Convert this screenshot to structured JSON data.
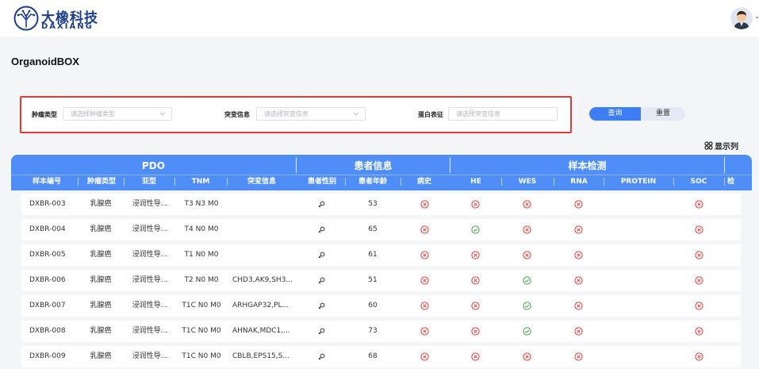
{
  "brand": {
    "name_cn": "大橡科技",
    "name_en": "DAXIANG",
    "color": "#1d3f8a"
  },
  "user": {
    "avatar_icon": "user-avatar-icon",
    "menu_icon": "chevron-down-icon"
  },
  "page": {
    "title": "OrganoidBOX"
  },
  "filters": {
    "tumor_type": {
      "label": "肿瘤类型",
      "placeholder": "请选择肿瘤类型"
    },
    "mutation": {
      "label": "突变信息",
      "placeholder": "请选择突变信息"
    },
    "protein": {
      "label": "蛋白表征",
      "placeholder": "请选择突变信息"
    },
    "highlight_color": "#e53935"
  },
  "buttons": {
    "query": "查询",
    "reset": "重置",
    "accent": "#3d7ef5"
  },
  "show_columns": {
    "label": "显示列",
    "icon": "grid-settings-icon"
  },
  "table": {
    "groups": [
      "PDO",
      "患者信息",
      "样本检测"
    ],
    "columns": [
      "样本编号",
      "肿瘤类型",
      "亚型",
      "TNM",
      "突变信息",
      "患者性别",
      "患者年龄",
      "病史",
      "HE",
      "WES",
      "RNA",
      "PROTEIN",
      "SOC",
      "检"
    ],
    "header_color": "#4f8df7",
    "rows": [
      {
        "id": "DXBR-003",
        "tumor": "乳腺癌",
        "subtype": "浸润性导...",
        "tnm": "T3 N3 M0",
        "mutation": "",
        "sex": "female",
        "age": "53",
        "history": "x",
        "he": "x",
        "wes": "x",
        "rna": "x",
        "protein": "",
        "soc": "x"
      },
      {
        "id": "DXBR-004",
        "tumor": "乳腺癌",
        "subtype": "浸润性导...",
        "tnm": "T4 N0 M0",
        "mutation": "",
        "sex": "female",
        "age": "65",
        "history": "x",
        "he": "ok",
        "wes": "x",
        "rna": "x",
        "protein": "",
        "soc": "x"
      },
      {
        "id": "DXBR-005",
        "tumor": "乳腺癌",
        "subtype": "浸润性导...",
        "tnm": "T1 N0 M0",
        "mutation": "",
        "sex": "female",
        "age": "61",
        "history": "x",
        "he": "x",
        "wes": "x",
        "rna": "x",
        "protein": "",
        "soc": "x"
      },
      {
        "id": "DXBR-006",
        "tumor": "乳腺癌",
        "subtype": "浸润性导...",
        "tnm": "T2 N0 M0",
        "mutation": "CHD3,AK9,SH3...",
        "sex": "female",
        "age": "51",
        "history": "x",
        "he": "x",
        "wes": "ok",
        "rna": "x",
        "protein": "",
        "soc": "x"
      },
      {
        "id": "DXBR-007",
        "tumor": "乳腺癌",
        "subtype": "浸润性导...",
        "tnm": "T1C N0 M0",
        "mutation": "ARHGAP32,PL...",
        "sex": "female",
        "age": "60",
        "history": "x",
        "he": "x",
        "wes": "ok",
        "rna": "x",
        "protein": "",
        "soc": "x"
      },
      {
        "id": "DXBR-008",
        "tumor": "乳腺癌",
        "subtype": "浸润性导...",
        "tnm": "T1C N0 M0",
        "mutation": "AHNAK,MDC1,...",
        "sex": "female",
        "age": "73",
        "history": "x",
        "he": "x",
        "wes": "ok",
        "rna": "x",
        "protein": "",
        "soc": "x"
      },
      {
        "id": "DXBR-009",
        "tumor": "乳腺癌",
        "subtype": "浸润性导...",
        "tnm": "T1C N0 M0",
        "mutation": "CBLB,EPS15,S...",
        "sex": "female",
        "age": "68",
        "history": "x",
        "he": "x",
        "wes": "x",
        "rna": "x",
        "protein": "",
        "soc": "x"
      }
    ],
    "status_colors": {
      "x": "#e53935",
      "ok": "#43a047",
      "female": "#333333"
    }
  }
}
